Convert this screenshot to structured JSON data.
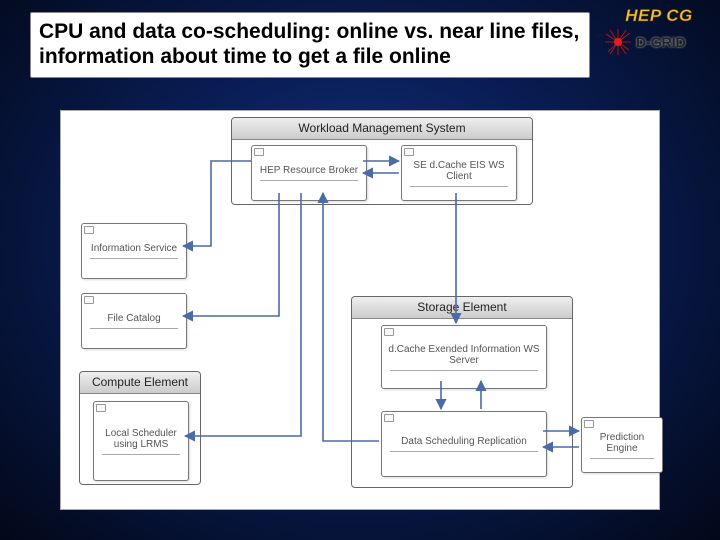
{
  "slide": {
    "title": "CPU and data co-scheduling: online vs. near line files, information about time to get a file online"
  },
  "logos": {
    "hepcg": "HEP CG",
    "dgrid": "D-GRID"
  },
  "diagram": {
    "containers": {
      "wms": "Workload Management System",
      "storage": "Storage Element",
      "compute": "Compute Element"
    },
    "nodes": {
      "hep_rb": "HEP Resource\nBroker",
      "se_client": "SE d.Cache\nEIS WS Client",
      "info_service": "Information\nService",
      "file_catalog": "File\nCatalog",
      "local_sched": "Local\nScheduler\nusing\nLRMS",
      "dcache_server": "d.Cache\nExended Information\nWS Server",
      "data_sched": "Data\nScheduling\nReplication",
      "prediction": "Prediction\nEngine"
    }
  }
}
